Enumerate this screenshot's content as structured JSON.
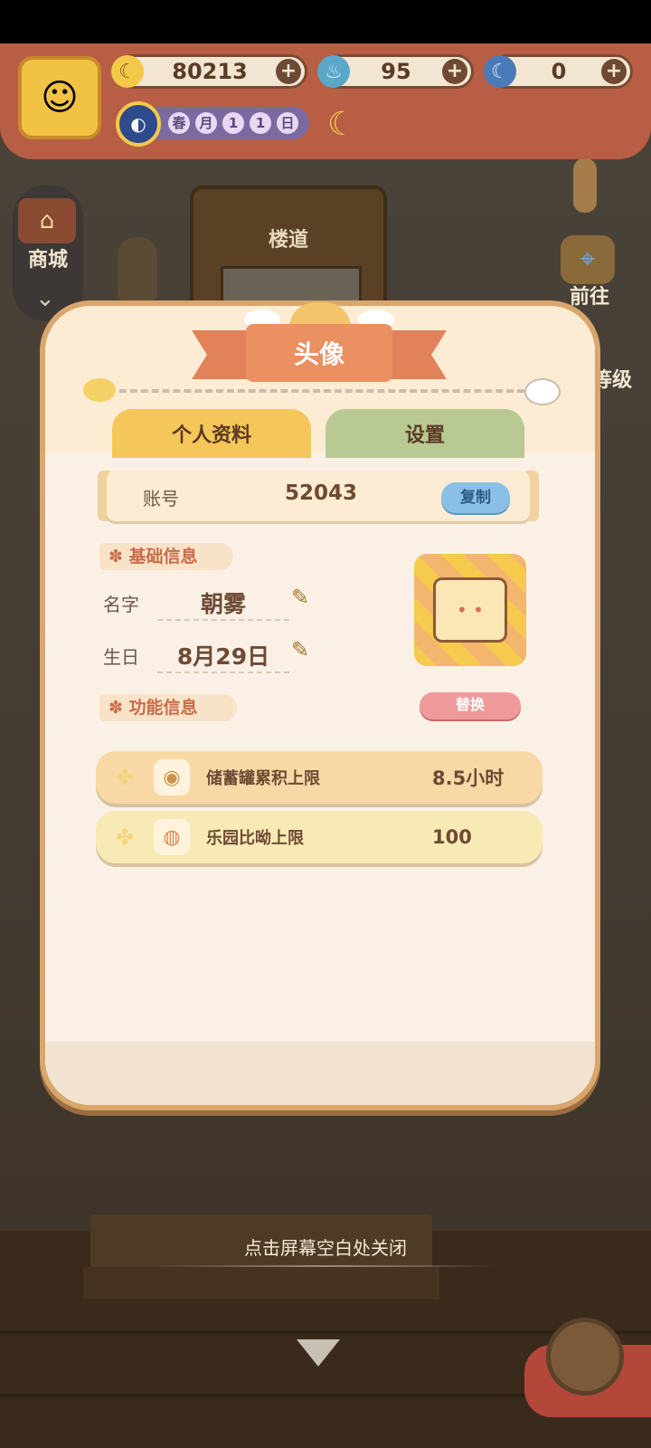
{
  "topbar": {
    "resources": [
      {
        "icon": "banana-icon",
        "value": "80213"
      },
      {
        "icon": "flame-icon",
        "value": "95"
      },
      {
        "icon": "blue-banana-icon",
        "value": "0"
      }
    ],
    "date_chars": [
      "春",
      "月",
      "1",
      "1",
      "日"
    ]
  },
  "side": {
    "shop_label": "商城",
    "goto_label": "前往",
    "level_label": "等级"
  },
  "scene": {
    "hallway_label": "楼道"
  },
  "modal": {
    "title": "头像",
    "tabs": [
      "个人资料",
      "设置"
    ],
    "account": {
      "label": "账号",
      "value": "52043",
      "copy_label": "复制"
    },
    "basic_section": "基础信息",
    "name": {
      "label": "名字",
      "value": "朝雾"
    },
    "birthday": {
      "label": "生日",
      "value": "8月29日"
    },
    "function_section": "功能信息",
    "replace_label": "替换",
    "stats": [
      {
        "name": "储蓄罐累积上限",
        "value": "8.5小时"
      },
      {
        "name": "乐园比呦上限",
        "value": "100"
      }
    ]
  },
  "close_hint": "点击屏幕空白处关闭",
  "colors": {
    "accent_orange": "#e2825a",
    "tab_profile": "#f5c659",
    "tab_settings": "#b9c993",
    "copy_button": "#8bc0e6",
    "replace_button": "#ef9a9a"
  }
}
